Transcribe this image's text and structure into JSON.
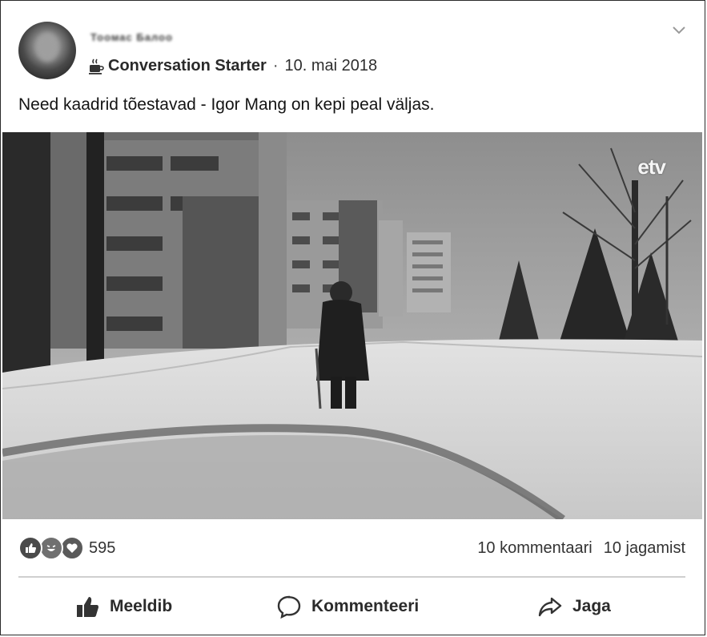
{
  "post": {
    "author": "Тоомас Балоо",
    "group": "Conversation Starter",
    "separator": "·",
    "date": "10. mai 2018",
    "text": "Need kaadrid tõestavad - Igor Mang on kepi peal väljas.",
    "watermark": "etv"
  },
  "stats": {
    "reaction_icons": [
      "like-icon",
      "haha-icon",
      "love-icon"
    ],
    "reaction_count": "595",
    "comments": "10 kommentaari",
    "shares": "10 jagamist"
  },
  "actions": {
    "like": "Meeldib",
    "comment": "Kommenteeri",
    "share": "Jaga"
  }
}
